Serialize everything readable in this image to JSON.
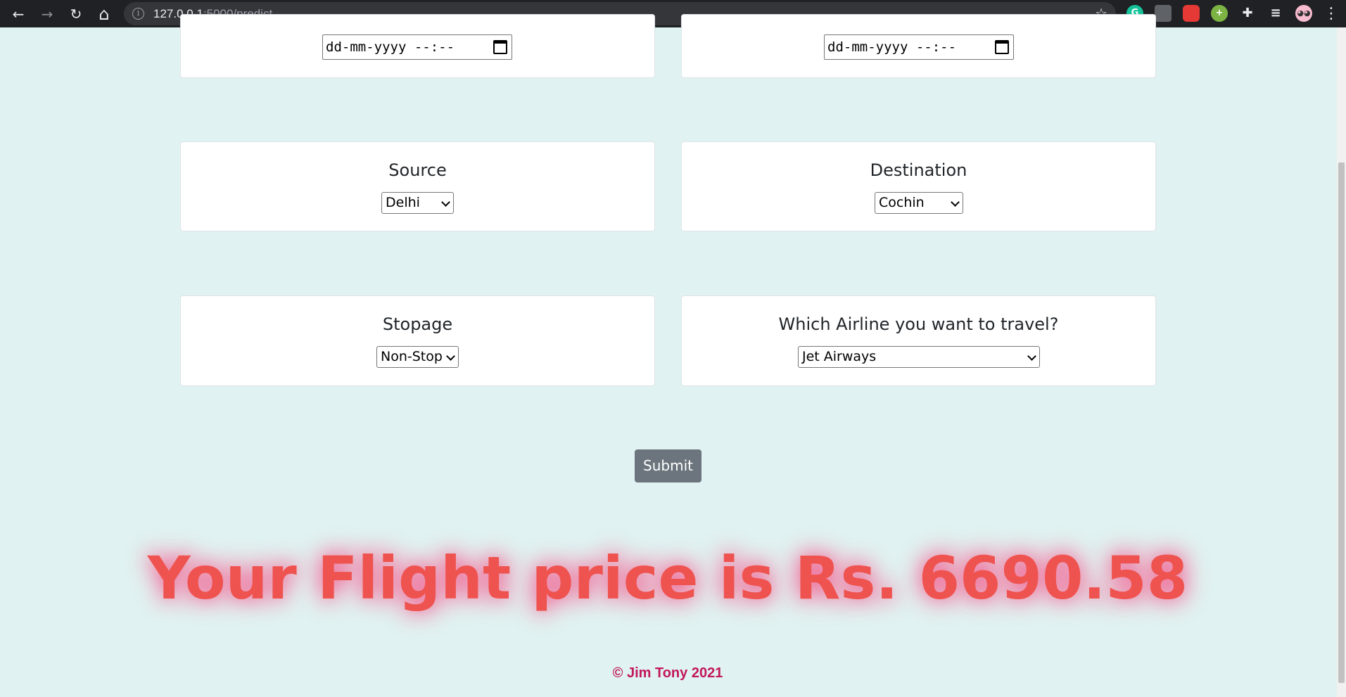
{
  "browser": {
    "url_host": "127.0.0.1",
    "url_path": ":5000/predict",
    "back_icon": "←",
    "forward_icon": "→",
    "reload_icon": "↻",
    "home_icon": "⌂",
    "star_icon": "☆",
    "menu_icon": "⋮"
  },
  "form": {
    "departure_placeholder": "dd-mm-yyyy --:--",
    "arrival_placeholder": "dd-mm-yyyy --:--",
    "source_label": "Source",
    "source_value": "Delhi",
    "destination_label": "Destination",
    "destination_value": "Cochin",
    "stopage_label": "Stopage",
    "stopage_value": "Non-Stop",
    "airline_label": "Which Airline you want to travel?",
    "airline_value": "Jet Airways",
    "submit_label": "Submit"
  },
  "result": {
    "text": "Your Flight price is Rs. 6690.58"
  },
  "footer": {
    "text": "© Jim Tony 2021"
  },
  "colors": {
    "page_bg": "#e0f2f1",
    "result_text": "#ef5350",
    "result_glow": "#f06292",
    "footer_text": "#c2185b",
    "submit_bg": "#6c757d"
  }
}
